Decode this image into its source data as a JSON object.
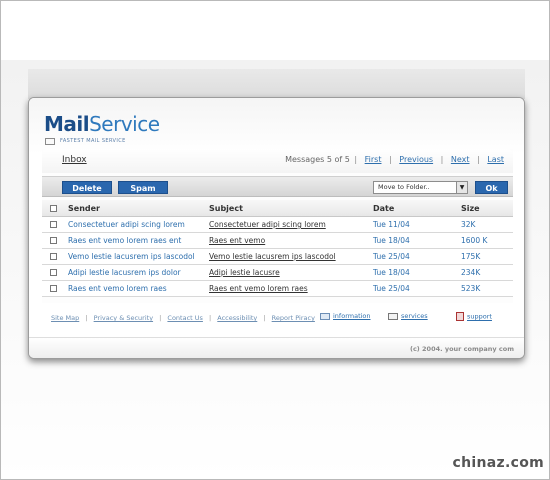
{
  "brand": {
    "name_bold": "Mail",
    "name_rest": "Service",
    "tagline": "FASTEST MAIL SERVICE"
  },
  "inbox": {
    "title": "Inbox",
    "messages_count": "Messages 5 of 5",
    "pager": {
      "first": "First",
      "previous": "Previous",
      "next": "Next",
      "last": "Last",
      "separator": "|"
    }
  },
  "toolbar": {
    "delete_label": "Delete",
    "spam_label": "Spam",
    "move_select": "Move to Folder..",
    "ok_label": "Ok"
  },
  "table": {
    "headers": {
      "sender": "Sender",
      "subject": "Subject",
      "date": "Date",
      "size": "Size"
    },
    "rows": [
      {
        "sender": "Consectetuer adipi scing lorem",
        "subject": "Consectetuer adipi scing lorem",
        "date": "Tue 11/04",
        "size": "32K"
      },
      {
        "sender": "Raes ent vemo lorem raes ent",
        "subject": "Raes ent vemo",
        "date": "Tue 18/04",
        "size": "1600 K"
      },
      {
        "sender": "Vemo lestie lacusrem ips lascodol",
        "subject": "Vemo lestie lacusrem ips lascodol",
        "date": "Tue 25/04",
        "size": "175K"
      },
      {
        "sender": "Adipi lestie lacusrem ips dolor",
        "subject": "Adipi lestie lacusre",
        "date": "Tue 18/04",
        "size": "234K"
      },
      {
        "sender": "Raes ent vemo lorem raes",
        "subject": "Raes ent vemo lorem raes",
        "date": "Tue 25/04",
        "size": "523K"
      }
    ]
  },
  "footer": {
    "links": [
      "Site Map",
      "Privacy & Security",
      "Contact Us",
      "Accessibility",
      "Report Piracy"
    ],
    "separator": "|",
    "quick": {
      "information": "information",
      "services": "services",
      "support": "support"
    },
    "copyright": "(c) 2004. your company com"
  },
  "watermark": "chinaz.com"
}
